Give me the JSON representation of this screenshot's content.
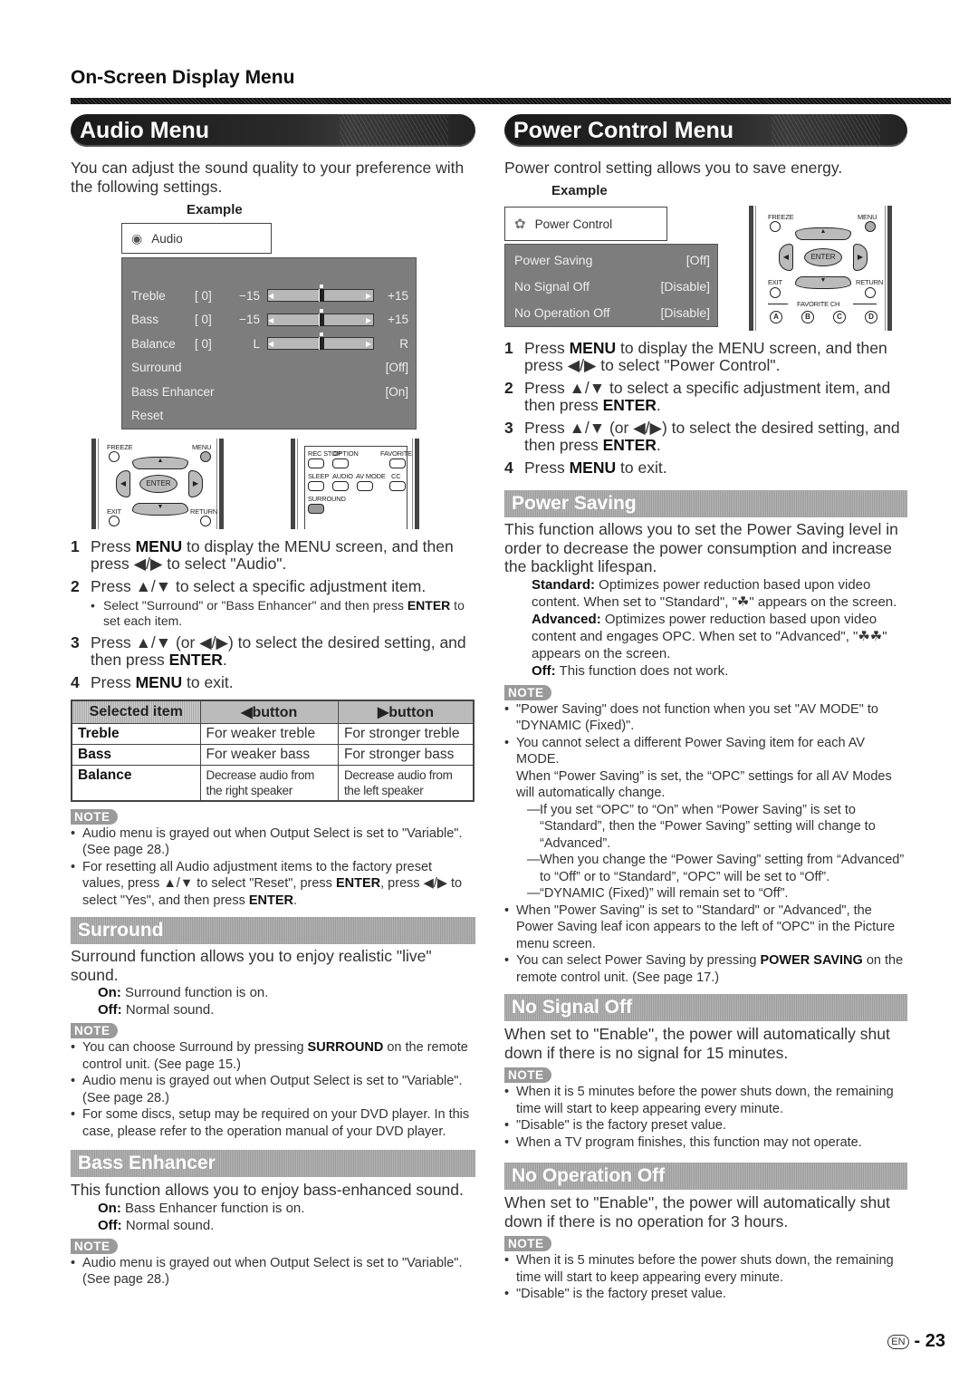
{
  "page": {
    "header": "On-Screen Display Menu",
    "lang_badge": "EN",
    "page_number": "- 23"
  },
  "audio": {
    "title": "Audio Menu",
    "intro": "You can adjust the sound quality to your preference with the following settings.",
    "example_label": "Example",
    "osd": {
      "title": "Audio",
      "rows": [
        {
          "label": "Treble",
          "value": "[ 0]",
          "min": "−15",
          "max": "+15",
          "slider_fraction": 0.5
        },
        {
          "label": "Bass",
          "value": "[ 0]",
          "min": "−15",
          "max": "+15",
          "slider_fraction": 0.5
        },
        {
          "label": "Balance",
          "value": "[ 0]",
          "min": "L",
          "max": "R",
          "slider_fraction": 0.5
        }
      ],
      "options": [
        {
          "label": "Surround",
          "value": "[Off]"
        },
        {
          "label": "Bass Enhancer",
          "value": "[On]"
        },
        {
          "label": "Reset",
          "value": ""
        }
      ]
    },
    "remote_a": {
      "freeze": "FREEZE",
      "menu": "MENU",
      "enter": "ENTER",
      "exit": "EXIT",
      "return": "RETURN"
    },
    "remote_b": {
      "labels_row1": [
        "REC STOP",
        "OPTION",
        "FAVORITE"
      ],
      "labels_row2": [
        "SLEEP",
        "AUDIO",
        "AV MODE",
        "CC"
      ],
      "surround": "SURROUND"
    },
    "steps": [
      {
        "num": "1",
        "pre": "Press ",
        "bold": "MENU",
        "post": " to display the MENU screen, and then press ◀/▶ to select \"Audio\"."
      },
      {
        "num": "2",
        "pre": "Press ▲/▼ to select a specific adjustment item.",
        "bold": "",
        "post": "",
        "sub": {
          "pre": "Select \"Surround\" or \"Bass Enhancer\" and then press ",
          "bold": "ENTER",
          "post": " to set each item."
        }
      },
      {
        "num": "3",
        "pre": "Press ▲/▼ (or ◀/▶) to select the desired setting, and then press ",
        "bold": "ENTER",
        "post": "."
      },
      {
        "num": "4",
        "pre": "Press ",
        "bold": "MENU",
        "post": " to exit."
      }
    ],
    "table": {
      "headers": [
        "Selected item",
        "◀button",
        "▶button"
      ],
      "rows": [
        [
          "Treble",
          "For weaker treble",
          "For stronger treble"
        ],
        [
          "Bass",
          "For weaker bass",
          "For stronger bass"
        ],
        [
          "Balance",
          "Decrease audio from the right speaker",
          "Decrease audio from the left speaker"
        ]
      ]
    },
    "note_label": "NOTE",
    "notes": [
      {
        "pre": "Audio menu is grayed out when Output Select is set to \"Variable\". (See page 28.)"
      },
      {
        "pre": "For resetting all Audio adjustment items to the factory preset values, press ▲/▼ to select \"Reset\", press ",
        "b1": "ENTER",
        "mid": ", press ◀/▶ to select \"Yes\", and then press ",
        "b2": "ENTER",
        "post": "."
      }
    ]
  },
  "surround": {
    "title": "Surround",
    "intro": "Surround function allows you to enjoy realistic \"live\" sound.",
    "on_label": "On:",
    "on_text": " Surround function is on.",
    "off_label": "Off:",
    "off_text": " Normal sound.",
    "notes": [
      {
        "pre": "You can choose Surround by pressing ",
        "bold": "SURROUND",
        "post": " on the remote control unit. (See page 15.)"
      },
      {
        "pre": "Audio menu is grayed out when Output Select is set to \"Variable\". (See page 28.)"
      },
      {
        "pre": "For some discs, setup may be required on your DVD player. In this case, please refer to the operation manual of your DVD player."
      }
    ]
  },
  "bass_enhancer": {
    "title": "Bass Enhancer",
    "intro": "This function allows you to enjoy bass-enhanced sound.",
    "on_label": "On:",
    "on_text": " Bass Enhancer function is on.",
    "off_label": "Off:",
    "off_text": " Normal sound.",
    "notes": [
      {
        "pre": "Audio menu is grayed out when Output Select is set to \"Variable\". (See page 28.)"
      }
    ]
  },
  "power": {
    "title": "Power Control Menu",
    "intro": "Power control setting allows you to save energy.",
    "example_label": "Example",
    "osd": {
      "title": "Power Control",
      "rows": [
        {
          "label": "Power Saving",
          "value": "[Off]"
        },
        {
          "label": "No Signal Off",
          "value": "[Disable]"
        },
        {
          "label": "No Operation Off",
          "value": "[Disable]"
        }
      ]
    },
    "remote": {
      "freeze": "FREEZE",
      "menu": "MENU",
      "enter": "ENTER",
      "exit": "EXIT",
      "return": "RETURN",
      "favorite": "FAVORITE CH",
      "keys": [
        "A",
        "B",
        "C",
        "D"
      ]
    },
    "steps": [
      {
        "num": "1",
        "pre": "Press ",
        "bold": "MENU",
        "post": " to display the MENU screen, and then press ◀/▶ to select \"Power Control\"."
      },
      {
        "num": "2",
        "pre": "Press ▲/▼ to select a specific adjustment item, and then press ",
        "bold": "ENTER",
        "post": "."
      },
      {
        "num": "3",
        "pre": "Press ▲/▼ (or ◀/▶) to select the desired setting, and then press ",
        "bold": "ENTER",
        "post": "."
      },
      {
        "num": "4",
        "pre": "Press ",
        "bold": "MENU",
        "post": " to exit."
      }
    ]
  },
  "power_saving": {
    "title": "Power Saving",
    "intro": "This function allows you to set the Power Saving level in order to decrease the power consumption and increase the backlight lifespan.",
    "defs": [
      {
        "label": "Standard:",
        "text": " Optimizes power reduction based upon video content. When set to \"Standard\", \"☘\" appears on the screen."
      },
      {
        "label": "Advanced:",
        "text": " Optimizes power reduction based upon video content and engages OPC. When set to \"Advanced\", \"☘☘\" appears on the screen."
      },
      {
        "label": "Off:",
        "text": " This function does not work."
      }
    ],
    "notes": [
      {
        "pre": "\"Power Saving\" does not function when you set \"AV MODE\" to \"DYNAMIC (Fixed)\"."
      },
      {
        "pre": "You cannot select a different Power Saving item for each AV MODE.",
        "extra": "When “Power Saving” is set, the “OPC” settings for all AV Modes will automatically change."
      },
      {
        "pre": "When \"Power Saving\" is set to \"Standard\" or \"Advanced\", the Power Saving leaf icon appears to the left of \"OPC\" in the Picture menu screen."
      },
      {
        "pre": "You can select Power Saving by pressing ",
        "bold": "POWER SAVING",
        "post": " on the remote control unit. (See page 17.)"
      }
    ],
    "dashes": [
      "If you set “OPC” to “On” when “Power Saving” is set to “Standard”, then the “Power Saving” setting will change to “Advanced”.",
      "When you change the “Power Saving” setting from “Advanced” to “Off” or to “Standard”, “OPC” will be set to “Off”.",
      "“DYNAMIC (Fixed)” will remain set to “Off”."
    ]
  },
  "no_signal": {
    "title": "No Signal Off",
    "intro": "When set to \"Enable\", the power will automatically shut down if there is no signal for 15 minutes.",
    "notes": [
      "When it is 5 minutes before the power shuts down, the remaining time will start to keep appearing every minute.",
      "\"Disable\" is the factory preset value.",
      "When a TV program finishes, this function may not operate."
    ]
  },
  "no_operation": {
    "title": "No Operation Off",
    "intro": "When set to \"Enable\", the power will automatically shut down if there is no operation for 3 hours.",
    "notes": [
      "When it is 5 minutes before the power shuts down, the remaining time will start to keep appearing every minute.",
      "\"Disable\" is the factory preset value."
    ]
  }
}
